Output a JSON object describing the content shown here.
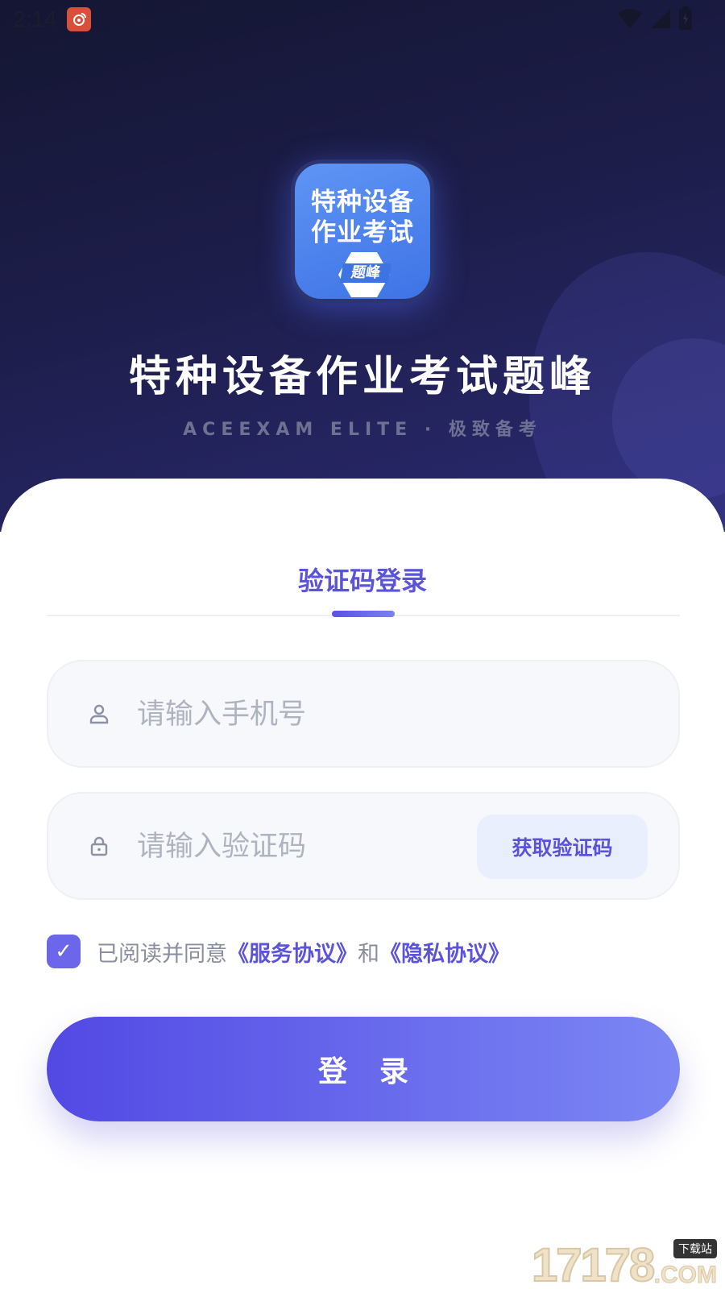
{
  "status_bar": {
    "time": "2:14",
    "icons": [
      "weibo-notification-icon",
      "wifi-icon",
      "signal-icon",
      "battery-icon"
    ]
  },
  "app": {
    "logo_line1": "特种设备",
    "logo_line2": "作业考试",
    "logo_badge": "题峰",
    "title": "特种设备作业考试题峰",
    "subtitle": "ACEEXAM ELITE · 极致备考"
  },
  "login": {
    "tab_label": "验证码登录",
    "phone_placeholder": "请输入手机号",
    "code_placeholder": "请输入验证码",
    "get_code_label": "获取验证码",
    "agree_prefix": "已阅读并同意",
    "service_link": "《服务协议》",
    "agree_and": "和",
    "privacy_link": "《隐私协议》",
    "checked": true,
    "login_button": "登录"
  },
  "watermark": {
    "number": "17178",
    "tag": "下载站",
    "suffix": ".COM"
  },
  "colors": {
    "accent": "#5b53d8",
    "hero_dark": "#141632",
    "hero_light": "#2b2a72",
    "logo_blue": "#3e73e6",
    "field_bg": "#f7f8fb",
    "code_btn_bg": "#eaeffd"
  }
}
